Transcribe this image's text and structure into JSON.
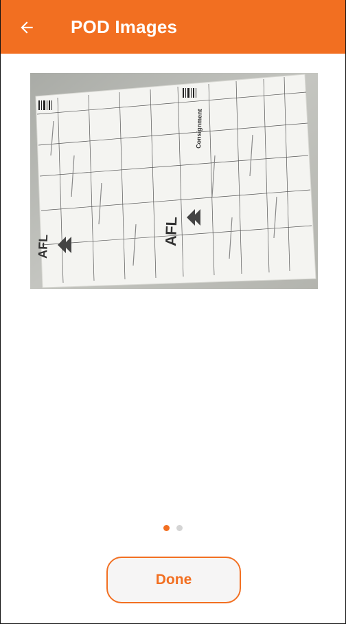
{
  "header": {
    "title": "POD Images",
    "back_icon": "arrow-left-icon"
  },
  "gallery": {
    "page_count": 2,
    "current_page": 1,
    "document": {
      "logo_text": "AFL",
      "consignment_label": "Consignment"
    }
  },
  "footer": {
    "done_label": "Done"
  },
  "colors": {
    "accent": "#f26f21",
    "inactive_dot": "#d4d4d4",
    "background": "#ffffff"
  }
}
